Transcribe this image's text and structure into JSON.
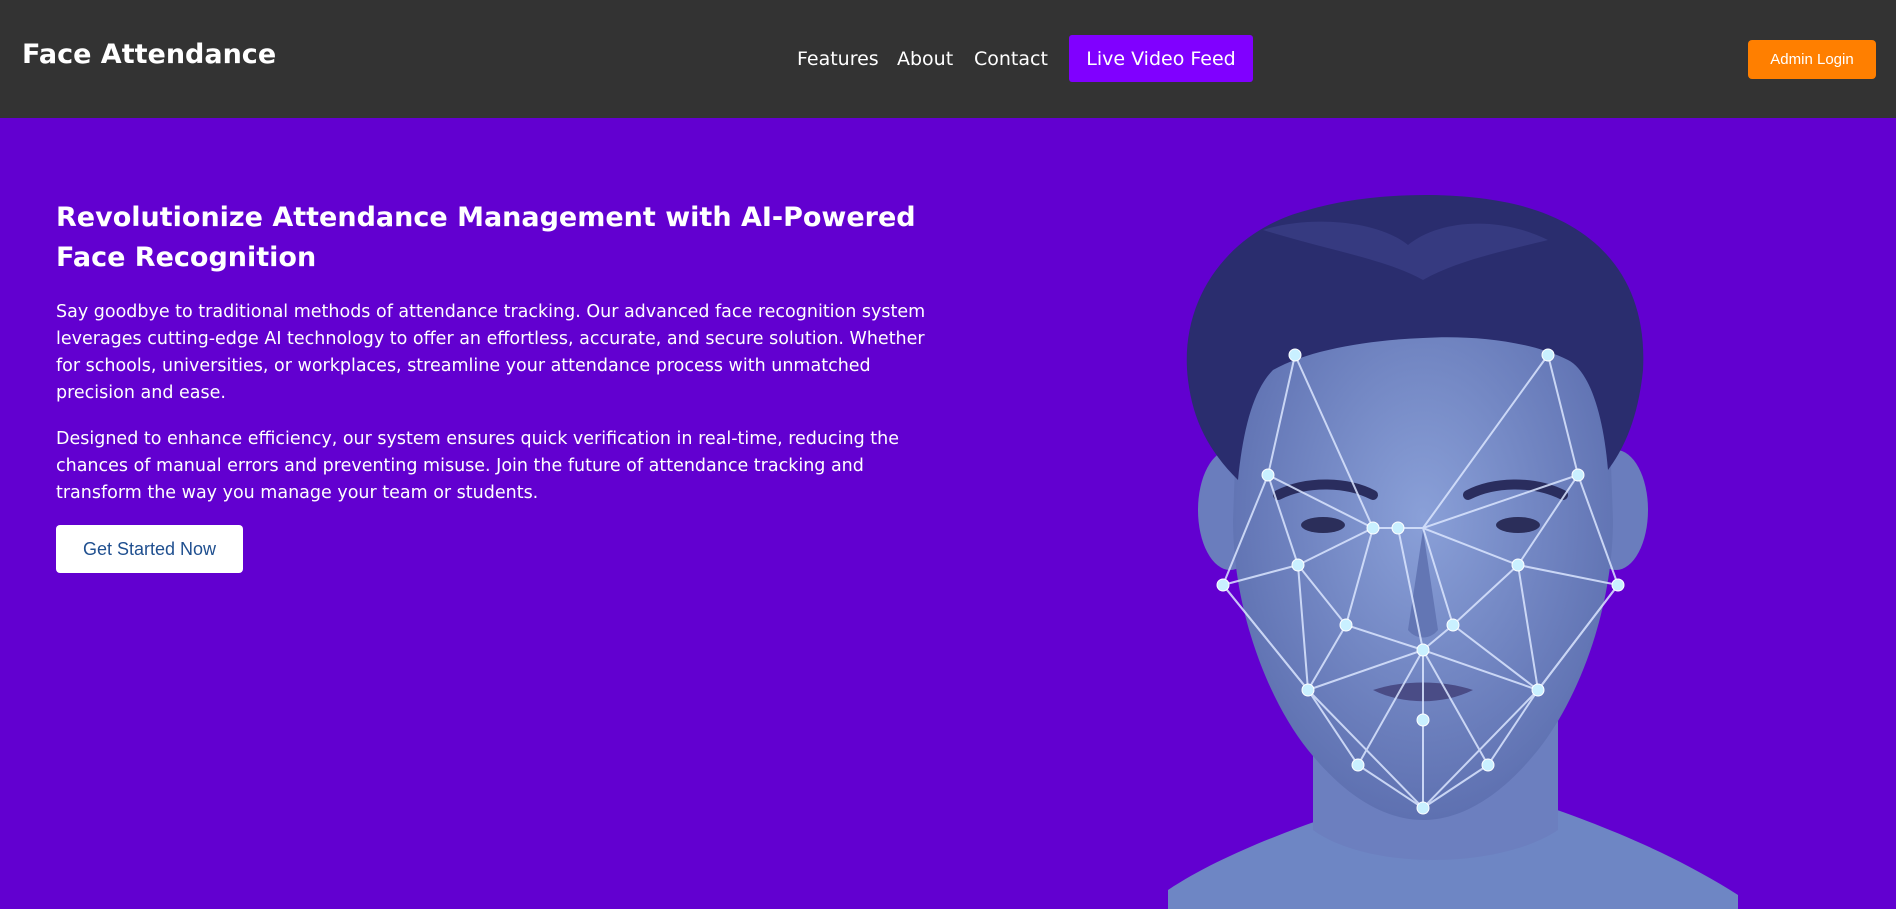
{
  "header": {
    "brand": "Face Attendance",
    "nav": {
      "features": "Features",
      "about": "About",
      "contact": "Contact"
    },
    "live_feed_label": "Live Video Feed",
    "admin_login_label": "Admin Login"
  },
  "hero": {
    "title": "Revolutionize Attendance Management with AI-Powered Face Recognition",
    "paragraph1": "Say goodbye to traditional methods of attendance tracking. Our advanced face recognition system leverages cutting-edge AI technology to offer an effortless, accurate, and secure solution. Whether for schools, universities, or workplaces, streamline your attendance process with unmatched precision and ease.",
    "paragraph2": "Designed to enhance efficiency, our system ensures quick verification in real-time, reducing the chances of manual errors and preventing misuse. Join the future of attendance tracking and transform the way you manage your team or students.",
    "cta_label": "Get Started Now"
  },
  "colors": {
    "navbar_bg": "#333333",
    "hero_bg": "#6200d0",
    "live_feed_bg": "#8000ff",
    "admin_login_bg": "#ff7f00",
    "cta_text": "#1f4f8f"
  }
}
